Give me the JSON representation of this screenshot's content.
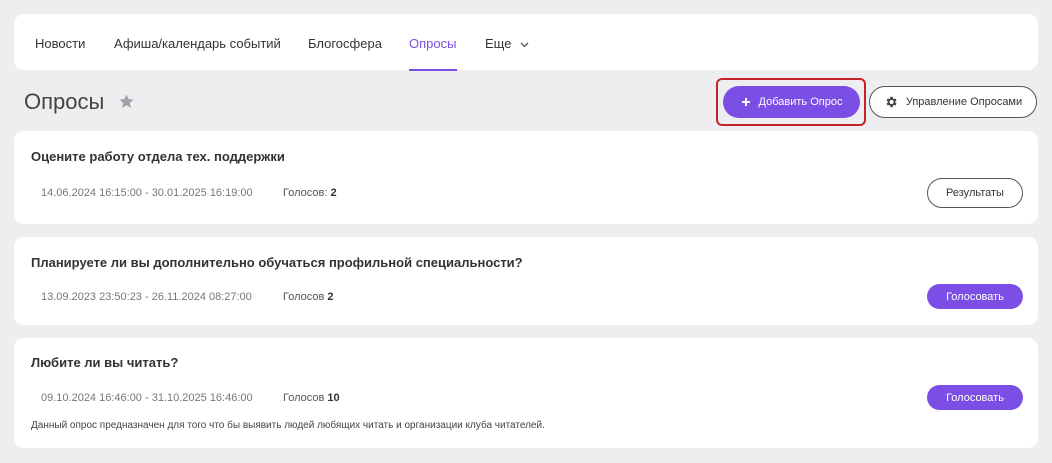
{
  "nav": {
    "items": [
      {
        "label": "Новости"
      },
      {
        "label": "Афиша/календарь событий"
      },
      {
        "label": "Блогосфера"
      },
      {
        "label": "Опросы"
      },
      {
        "label": "Еще"
      }
    ],
    "active": "Опросы"
  },
  "header": {
    "title": "Опросы",
    "add_label": "Добавить Опрос",
    "manage_label": "Управление Опросами"
  },
  "polls": [
    {
      "title": "Оцените работу отдела тех. поддержки",
      "dates": "14.06.2024 16:15:00 - 30.01.2025 16:19:00",
      "votes_label": "Голосов:",
      "votes": "2",
      "action": "Результаты"
    },
    {
      "title": "Планируете ли вы дополнительно обучаться профильной специальности?",
      "dates": "13.09.2023 23:50:23 - 26.11.2024 08:27:00",
      "votes_label": "Голосов",
      "votes": "2",
      "action": "Голосовать"
    },
    {
      "title": "Любите ли вы читать?",
      "dates": "09.10.2024 16:46:00 - 31.10.2025 16:46:00",
      "votes_label": "Голосов",
      "votes": "10",
      "action": "Голосовать",
      "description": "Данный опрос предназначен для того что бы выявить людей любящих читать и организации клуба читателей."
    }
  ],
  "colors": {
    "accent": "#7b4fe6",
    "highlight_border": "#c6242b",
    "background": "#eeeef0"
  }
}
